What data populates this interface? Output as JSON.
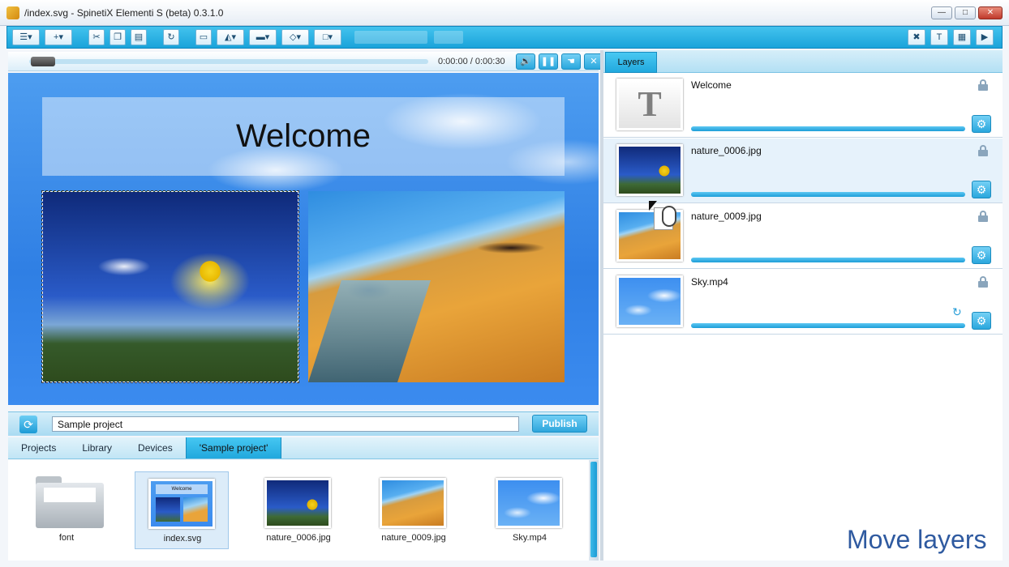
{
  "window": {
    "title": "/index.svg - SpinetiX Elementi S (beta) 0.3.1.0",
    "minimize": "—",
    "maximize": "□",
    "close": "✕"
  },
  "toolbar": {
    "icons": [
      "document-menu-icon",
      "new-layer-icon",
      "cut-icon",
      "copy-icon",
      "paste-icon",
      "redo-icon",
      "rectangle-icon",
      "align-icon",
      "distribute-icon",
      "fill-icon",
      "stroke-icon"
    ],
    "right_icons": [
      "delete-layer-icon",
      "add-text-icon",
      "add-image-icon",
      "add-media-icon"
    ]
  },
  "player": {
    "time": "0:00:00 / 0:00:30",
    "progress": 0.0
  },
  "canvas": {
    "welcome": "Welcome"
  },
  "project": {
    "name": "Sample project",
    "publish_label": "Publish"
  },
  "tabs": [
    {
      "label": "Projects"
    },
    {
      "label": "Library"
    },
    {
      "label": "Devices"
    },
    {
      "label": "'Sample project'"
    }
  ],
  "files": [
    {
      "label": "font"
    },
    {
      "label": "index.svg"
    },
    {
      "label": "nature_0006.jpg"
    },
    {
      "label": "nature_0009.jpg"
    },
    {
      "label": "Sky.mp4"
    }
  ],
  "layers": {
    "tab_label": "Layers",
    "items": [
      {
        "name": "Welcome",
        "thumb_text": "T"
      },
      {
        "name": "nature_0006.jpg"
      },
      {
        "name": "nature_0009.jpg"
      },
      {
        "name": "Sky.mp4"
      }
    ]
  },
  "caption": "Move layers",
  "colors": {
    "accent": "#22a9de",
    "caption": "#2f5aa0"
  }
}
